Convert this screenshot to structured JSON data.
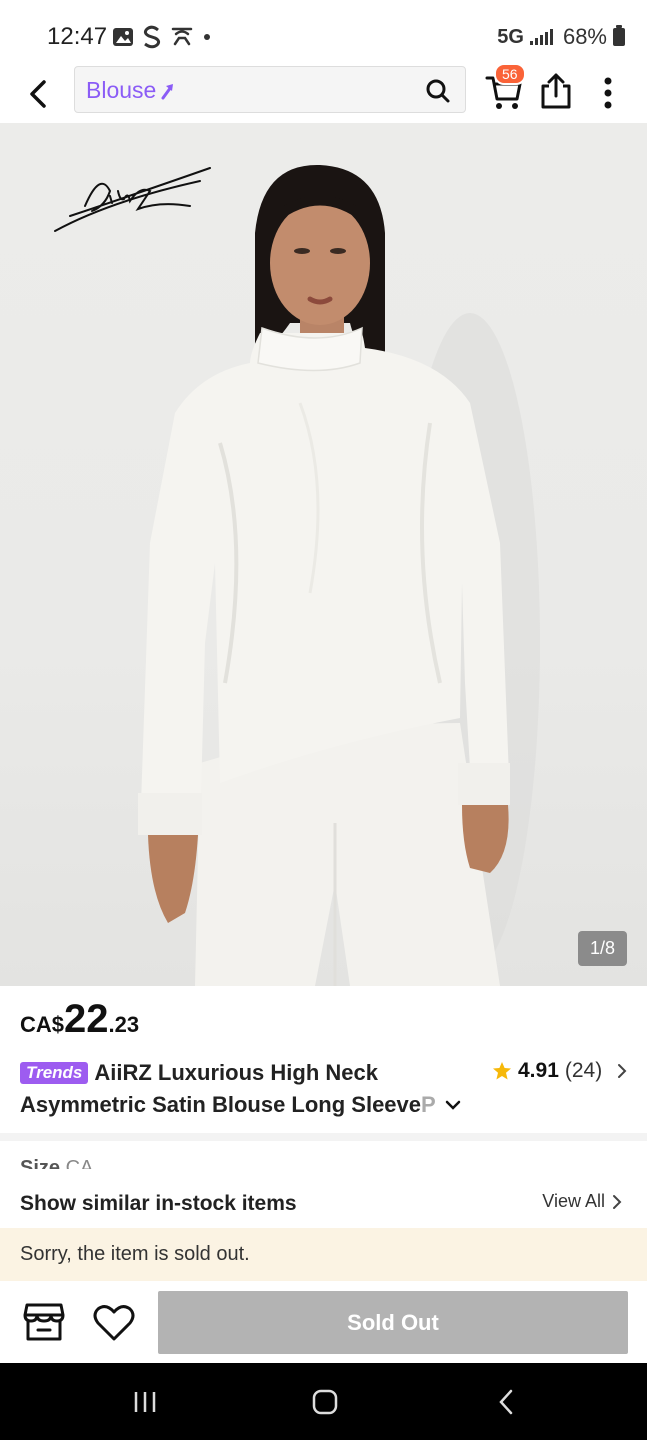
{
  "status_bar": {
    "time": "12:47",
    "network": "5G",
    "battery": "68%"
  },
  "header": {
    "search_text": "Blouse",
    "cart_badge": "56",
    "icons": [
      "back-arrow-icon",
      "search-icon",
      "cart-icon",
      "share-icon",
      "more-vertical-icon"
    ]
  },
  "gallery": {
    "brand_signature": "AiirZ",
    "counter": "1/8"
  },
  "product": {
    "price_currency": "CA$",
    "price_main": "22",
    "price_decimal": ".23",
    "badge": "Trends",
    "title_line1": "AiiRZ Luxurious High Neck",
    "title_line2": "Asymmetric Satin Blouse Long Sleeve ",
    "title_line2_fade": "P",
    "rating_score": "4.91",
    "rating_count": "(24)"
  },
  "size_row": {
    "label": "Size",
    "value": "CA"
  },
  "similar": {
    "title": "Show similar in-stock items",
    "view_all": "View All"
  },
  "notice": {
    "text": "Sorry, the item is sold out."
  },
  "bottom_bar": {
    "button_label": "Sold Out"
  },
  "colors": {
    "accent_purple": "#9d5cf0",
    "badge_orange": "#fa6338",
    "sold_out_grey": "#b3b3b3",
    "notice_bg": "#fbf3e3"
  }
}
